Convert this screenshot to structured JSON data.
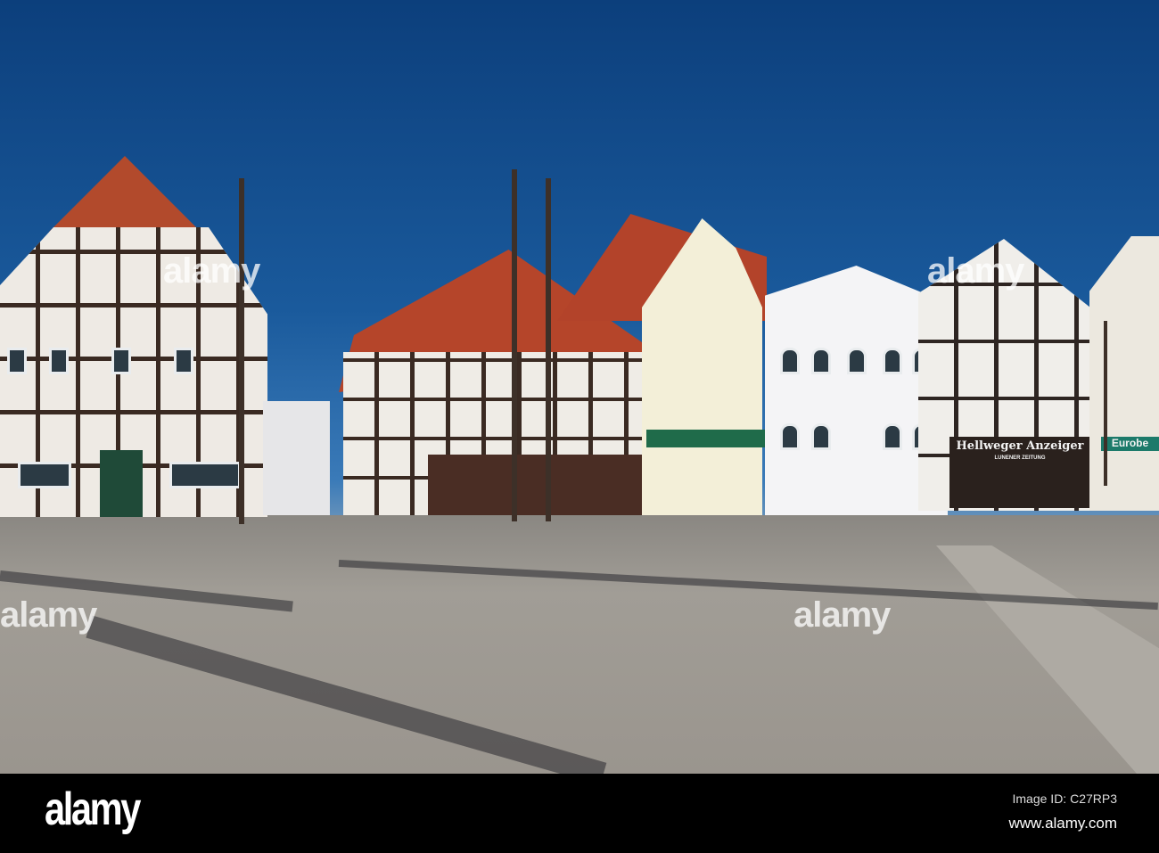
{
  "photo": {
    "signs": {
      "shop_main": "Hellweger Anzeiger",
      "shop_sub": "LUNENER ZEITUNG",
      "shop_right": "Eurobe"
    },
    "watermark_text": "alamy",
    "colors": {
      "sky": "#0c3f7c",
      "roof": "#b5452a",
      "pavement": "#9a958e"
    }
  },
  "footer": {
    "brand": "alamy",
    "image_id": "Image ID: C27RP3",
    "website": "www.alamy.com"
  }
}
